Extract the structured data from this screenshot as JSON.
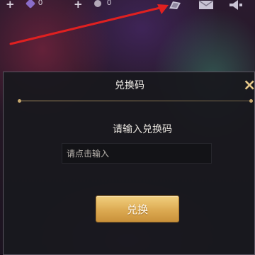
{
  "topbar": {
    "diamond_count": "0",
    "coupon_count": "0",
    "plus_1": "+",
    "plus_2": "+",
    "icons": [
      "diamond-icon",
      "coupon-icon",
      "gift-code-icon",
      "mail-icon",
      "announcement-icon"
    ]
  },
  "dialog": {
    "title": "兑换码",
    "prompt": "请输入兑换码",
    "input_placeholder": "请点击输入",
    "input_value": "",
    "confirm_label": "兑换",
    "close_glyph": "×"
  },
  "colors": {
    "accent_gold": "#dcaa52",
    "arrow_red": "#e02020",
    "dialog_bg": "#18181e"
  }
}
